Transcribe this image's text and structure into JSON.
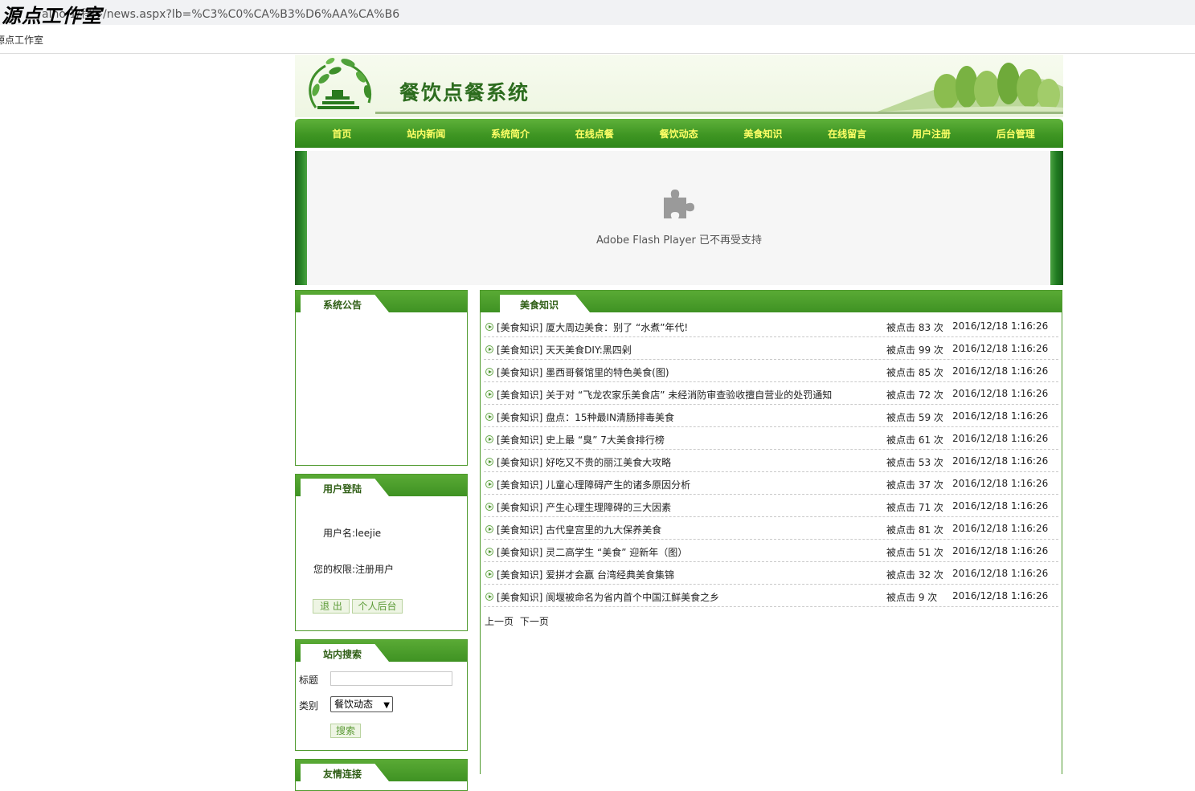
{
  "browser": {
    "address": "alho  1/程序/news.aspx?lb=%C3%C0%CA%B3%D6%AA%CA%B6",
    "watermark": "源点工作室",
    "tab_title": "源点工作室"
  },
  "header": {
    "title": "餐饮点餐系统"
  },
  "nav": {
    "items": [
      "首页",
      "站内新闻",
      "系统简介",
      "在线点餐",
      "餐饮动态",
      "美食知识",
      "在线留言",
      "用户注册",
      "后台管理"
    ]
  },
  "flash": {
    "message": "Adobe Flash Player 已不再受支持",
    "icon": "puzzle-icon"
  },
  "sidebar": {
    "notice": {
      "title": "系统公告"
    },
    "login": {
      "title": "用户登陆",
      "username_line": "用户名:leejie",
      "role_line": "您的权限:注册用户",
      "logout_label": "退 出",
      "backend_label": "个人后台"
    },
    "search": {
      "title": "站内搜索",
      "title_label": "标题",
      "title_value": "",
      "category_label": "类别",
      "category_value": "餐饮动态",
      "search_label": "搜索"
    },
    "links": {
      "title": "友情连接"
    }
  },
  "main": {
    "title": "美食知识",
    "news": [
      {
        "title": "[美食知识] 厦大周边美食：别了 “水煮”年代!",
        "hits": "被点击 83 次",
        "date": "2016/12/18 1:16:26"
      },
      {
        "title": "[美食知识] 天天美食DIY:黑四剁",
        "hits": "被点击 99 次",
        "date": "2016/12/18 1:16:26"
      },
      {
        "title": "[美食知识] 墨西哥餐馆里的特色美食(图)",
        "hits": "被点击 85 次",
        "date": "2016/12/18 1:16:26"
      },
      {
        "title": "[美食知识] 关于对 “飞龙农家乐美食店” 未经消防审查验收擅自营业的处罚通知",
        "hits": "被点击 72 次",
        "date": "2016/12/18 1:16:26"
      },
      {
        "title": "[美食知识] 盘点：15种最IN清肠排毒美食",
        "hits": "被点击 59 次",
        "date": "2016/12/18 1:16:26"
      },
      {
        "title": "[美食知识] 史上最 “臭” 7大美食排行榜",
        "hits": "被点击 61 次",
        "date": "2016/12/18 1:16:26"
      },
      {
        "title": "[美食知识] 好吃又不贵的丽江美食大攻略",
        "hits": "被点击 53 次",
        "date": "2016/12/18 1:16:26"
      },
      {
        "title": "[美食知识] 儿童心理障碍产生的诸多原因分析",
        "hits": "被点击 37 次",
        "date": "2016/12/18 1:16:26"
      },
      {
        "title": "[美食知识] 产生心理生理障碍的三大因素",
        "hits": "被点击 71 次",
        "date": "2016/12/18 1:16:26"
      },
      {
        "title": "[美食知识] 古代皇宫里的九大保养美食",
        "hits": "被点击 81 次",
        "date": "2016/12/18 1:16:26"
      },
      {
        "title": "[美食知识] 灵二高学生 “美食” 迎新年（图）",
        "hits": "被点击 51 次",
        "date": "2016/12/18 1:16:26"
      },
      {
        "title": "[美食知识] 爱拼才会赢 台湾经典美食集锦",
        "hits": "被点击 32 次",
        "date": "2016/12/18 1:16:26"
      },
      {
        "title": "[美食知识] 阆堰被命名为省内首个中国江鲜美食之乡",
        "hits": "被点击 9 次",
        "date": "2016/12/18 1:16:26"
      }
    ],
    "pager": {
      "prev": "上一页",
      "next": "下一页"
    }
  },
  "colors": {
    "nav_green": "#3f9623",
    "nav_text": "#ffff66",
    "title_green": "#2c6c1e",
    "border_green": "#4f9a2e"
  }
}
